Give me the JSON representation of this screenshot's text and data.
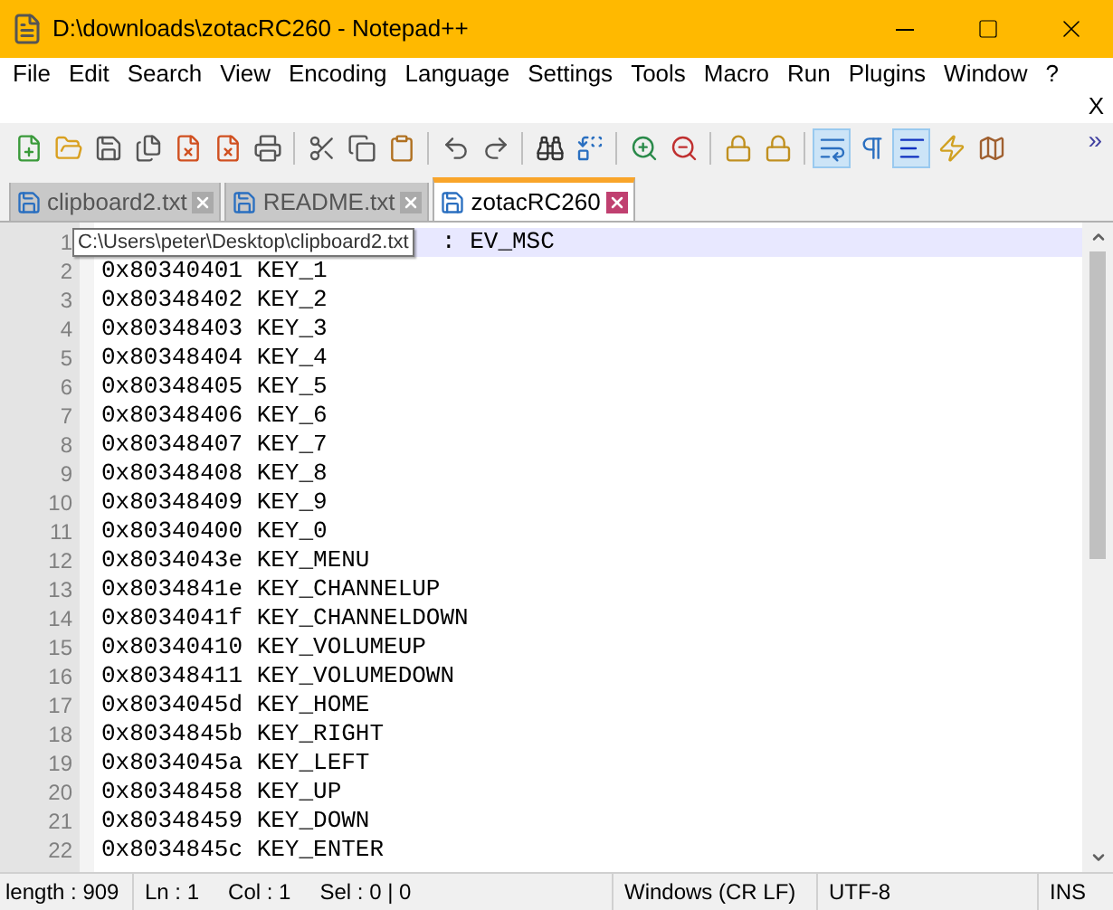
{
  "window": {
    "title": "D:\\downloads\\zotacRC260 - Notepad++"
  },
  "menu": [
    "File",
    "Edit",
    "Search",
    "View",
    "Encoding",
    "Language",
    "Settings",
    "Tools",
    "Macro",
    "Run",
    "Plugins",
    "Window",
    "?"
  ],
  "close_document": "X",
  "toolbar": [
    {
      "kind": "new",
      "selected": false
    },
    {
      "kind": "open",
      "selected": false
    },
    {
      "kind": "save",
      "selected": false
    },
    {
      "kind": "saveall",
      "selected": false
    },
    {
      "kind": "close",
      "selected": false
    },
    {
      "kind": "closeall",
      "selected": false
    },
    {
      "kind": "print",
      "selected": false
    },
    {
      "kind": "sep"
    },
    {
      "kind": "cut",
      "selected": false
    },
    {
      "kind": "copy",
      "selected": false
    },
    {
      "kind": "paste",
      "selected": false
    },
    {
      "kind": "sep"
    },
    {
      "kind": "undo",
      "selected": false
    },
    {
      "kind": "redo",
      "selected": false
    },
    {
      "kind": "sep"
    },
    {
      "kind": "find",
      "selected": false
    },
    {
      "kind": "replace",
      "selected": false
    },
    {
      "kind": "sep"
    },
    {
      "kind": "zoomin",
      "selected": false
    },
    {
      "kind": "zoomout",
      "selected": false
    },
    {
      "kind": "sep"
    },
    {
      "kind": "lock",
      "selected": false
    },
    {
      "kind": "lock",
      "selected": false
    },
    {
      "kind": "sep"
    },
    {
      "kind": "wrap",
      "selected": true
    },
    {
      "kind": "pilcrow",
      "selected": false
    },
    {
      "kind": "indent",
      "selected": true
    },
    {
      "kind": "flash",
      "selected": false
    },
    {
      "kind": "map",
      "selected": false
    }
  ],
  "overflow": "»",
  "tabs": [
    {
      "label": "clipboard2.txt",
      "selected": false
    },
    {
      "label": "README.txt",
      "selected": false
    },
    {
      "label": "zotacRC260",
      "selected": true
    }
  ],
  "tooltip": "C:\\Users\\peter\\Desktop\\clipboard2.txt",
  "lines": [
    {
      "number": "1",
      "text": ": EV_MSC",
      "current": true
    },
    {
      "number": "2",
      "text": "0x80340401 KEY_1",
      "current": false
    },
    {
      "number": "3",
      "text": "0x80348402 KEY_2",
      "current": false
    },
    {
      "number": "4",
      "text": "0x80348403 KEY_3",
      "current": false
    },
    {
      "number": "5",
      "text": "0x80348404 KEY_4",
      "current": false
    },
    {
      "number": "6",
      "text": "0x80348405 KEY_5",
      "current": false
    },
    {
      "number": "7",
      "text": "0x80348406 KEY_6",
      "current": false
    },
    {
      "number": "8",
      "text": "0x80348407 KEY_7",
      "current": false
    },
    {
      "number": "9",
      "text": "0x80348408 KEY_8",
      "current": false
    },
    {
      "number": "10",
      "text": "0x80348409 KEY_9",
      "current": false
    },
    {
      "number": "11",
      "text": "0x80340400 KEY_0",
      "current": false
    },
    {
      "number": "12",
      "text": "0x8034043e KEY_MENU",
      "current": false
    },
    {
      "number": "13",
      "text": "0x8034841e KEY_CHANNELUP",
      "current": false
    },
    {
      "number": "14",
      "text": "0x8034041f KEY_CHANNELDOWN",
      "current": false
    },
    {
      "number": "15",
      "text": "0x80340410 KEY_VOLUMEUP",
      "current": false
    },
    {
      "number": "16",
      "text": "0x80348411 KEY_VOLUMEDOWN",
      "current": false
    },
    {
      "number": "17",
      "text": "0x8034045d KEY_HOME",
      "current": false
    },
    {
      "number": "18",
      "text": "0x8034845b KEY_RIGHT",
      "current": false
    },
    {
      "number": "19",
      "text": "0x8034045a KEY_LEFT",
      "current": false
    },
    {
      "number": "20",
      "text": "0x80348458 KEY_UP",
      "current": false
    },
    {
      "number": "21",
      "text": "0x80348459 KEY_DOWN",
      "current": false
    },
    {
      "number": "22",
      "text": "0x8034845c KEY_ENTER",
      "current": false
    }
  ],
  "status_bar": {
    "length": "length : 909",
    "ln": "Ln : 1",
    "col": "Col : 1",
    "sel": "Sel : 0 | 0",
    "eol": "Windows (CR LF)",
    "encoding": "UTF-8",
    "mode": "INS"
  }
}
